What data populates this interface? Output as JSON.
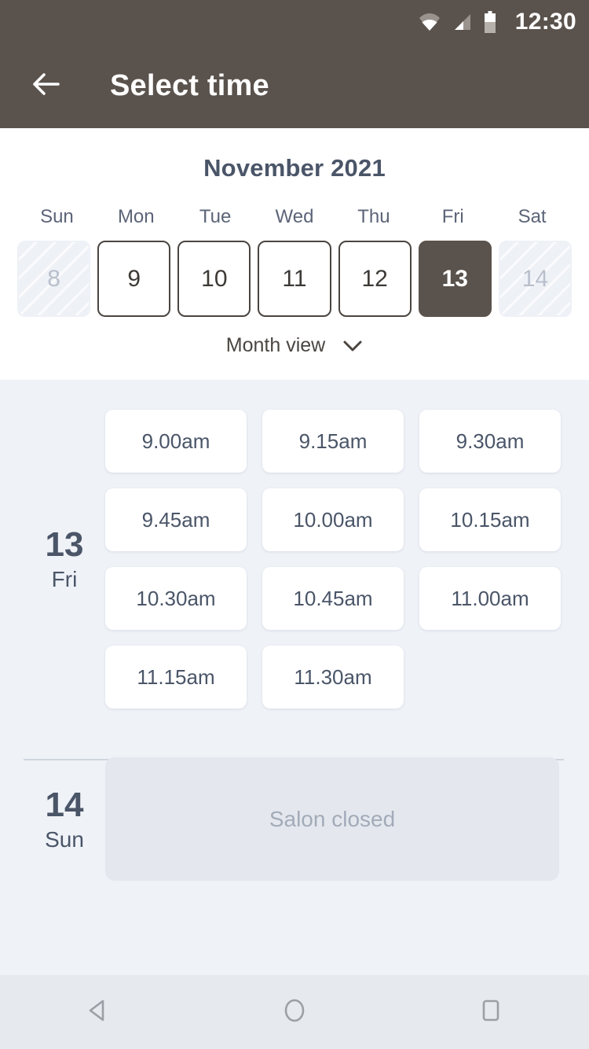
{
  "statusbar": {
    "time": "12:30",
    "icons": [
      "wifi-icon",
      "cell-signal-icon",
      "battery-icon"
    ]
  },
  "appbar": {
    "back_icon": "back-arrow-icon",
    "title": "Select time"
  },
  "calendar": {
    "month_label": "November 2021",
    "weekdays": [
      "Sun",
      "Mon",
      "Tue",
      "Wed",
      "Thu",
      "Fri",
      "Sat"
    ],
    "days": [
      {
        "num": "8",
        "state": "disabled"
      },
      {
        "num": "9",
        "state": "normal"
      },
      {
        "num": "10",
        "state": "normal"
      },
      {
        "num": "11",
        "state": "normal"
      },
      {
        "num": "12",
        "state": "normal"
      },
      {
        "num": "13",
        "state": "selected"
      },
      {
        "num": "14",
        "state": "disabled"
      }
    ],
    "view_toggle": {
      "label": "Month view",
      "icon": "chevron-down-icon"
    }
  },
  "schedule": {
    "groups": [
      {
        "day_num": "13",
        "day_of_week": "Fri",
        "slots": [
          "9.00am",
          "9.15am",
          "9.30am",
          "9.45am",
          "10.00am",
          "10.15am",
          "10.30am",
          "10.45am",
          "11.00am",
          "11.15am",
          "11.30am"
        ],
        "closed_message": null
      },
      {
        "day_num": "14",
        "day_of_week": "Sun",
        "slots": [],
        "closed_message": "Salon closed"
      }
    ]
  },
  "navbar": {
    "buttons": [
      {
        "name": "back-triangle-icon"
      },
      {
        "name": "home-circle-icon"
      },
      {
        "name": "recents-square-icon"
      }
    ]
  },
  "colors": {
    "brand": "#5a524c",
    "panel_bg": "#eff2f7",
    "card_bg": "#ffffff",
    "text_primary": "#4a5568",
    "text_muted": "#a3abb9",
    "closed_bg": "#e4e8ee"
  }
}
